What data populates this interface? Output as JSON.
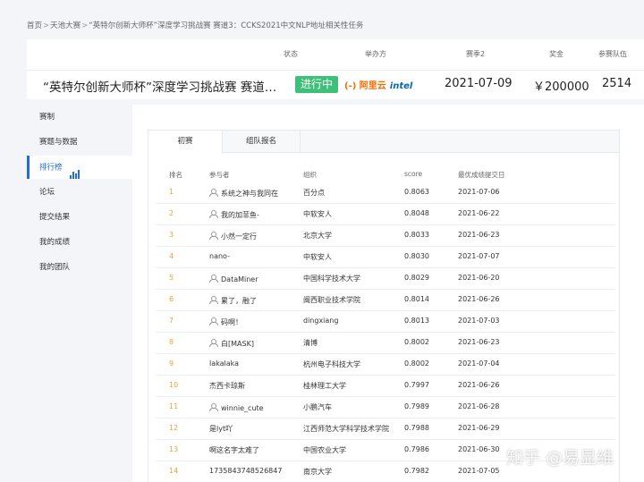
{
  "breadcrumb": [
    "首页",
    "天池大赛",
    "“英特尔创新大师杯”深度学习挑战赛 赛道3：CCKS2021中文NLP地址相关性任务"
  ],
  "header": {
    "labels": {
      "status": "状态",
      "organizer": "举办方",
      "season": "赛季2",
      "prize": "奖金",
      "participants": "参赛队伍"
    },
    "title": "“英特尔创新大师杯”深度学习挑战赛 赛道3：CCKS2021中文NLP地址相关性任务",
    "status": "进行中",
    "organizer_logo": {
      "aliyun": "(-) 阿里云",
      "intel": "intel"
    },
    "season_date": "2021-07-09",
    "prize": "￥200000",
    "participants": "2514"
  },
  "sidebar": {
    "items": [
      {
        "label": "赛制"
      },
      {
        "label": "赛题与数据"
      },
      {
        "label": "排行榜"
      },
      {
        "label": "论坛"
      },
      {
        "label": "提交结果"
      },
      {
        "label": "我的成绩"
      },
      {
        "label": "我的团队"
      }
    ],
    "active_index": 2
  },
  "tabs": [
    {
      "label": "初赛"
    },
    {
      "label": "组队报名"
    }
  ],
  "leaderboard": {
    "columns": [
      "排名",
      "参与者",
      "组织",
      "score",
      "最优成绩提交日"
    ],
    "rows": [
      {
        "rank": "1",
        "name": "系统之神与我同在",
        "org": "百分点",
        "score": "0.8063",
        "date": "2021-07-06",
        "avatar": true
      },
      {
        "rank": "2",
        "name": "我的加菲鱼-",
        "org": "中软安人",
        "score": "0.8048",
        "date": "2021-06-22",
        "avatar": true
      },
      {
        "rank": "3",
        "name": "小然一定行",
        "org": "北京大学",
        "score": "0.8033",
        "date": "2021-06-23",
        "avatar": true
      },
      {
        "rank": "4",
        "name": "nano-",
        "org": "中软安人",
        "score": "0.8030",
        "date": "2021-07-07",
        "avatar": false
      },
      {
        "rank": "5",
        "name": "DataMiner",
        "org": "中国科学技术大学",
        "score": "0.8029",
        "date": "2021-06-20",
        "avatar": true
      },
      {
        "rank": "6",
        "name": "累了，融了",
        "org": "闽西职业技术学院",
        "score": "0.8014",
        "date": "2021-06-26",
        "avatar": true
      },
      {
        "rank": "7",
        "name": "码啊！",
        "org": "dingxiang",
        "score": "0.8013",
        "date": "2021-07-03",
        "avatar": true
      },
      {
        "rank": "8",
        "name": "白[MASK]",
        "org": "清博",
        "score": "0.8002",
        "date": "2021-06-23",
        "avatar": true
      },
      {
        "rank": "9",
        "name": "lakalaka",
        "org": "杭州电子科技大学",
        "score": "0.8002",
        "date": "2021-07-04",
        "avatar": false
      },
      {
        "rank": "10",
        "name": "杰西卡琼斯",
        "org": "桂林理工大学",
        "score": "0.7997",
        "date": "2021-06-26",
        "avatar": false
      },
      {
        "rank": "11",
        "name": "winnie_cute",
        "org": "小鹏汽车",
        "score": "0.7989",
        "date": "2021-06-28",
        "avatar": true
      },
      {
        "rank": "12",
        "name": "是lyt吖",
        "org": "江西师范大学科学技术学院",
        "score": "0.7988",
        "date": "2021-06-29",
        "avatar": false
      },
      {
        "rank": "13",
        "name": "啊这名字太难了",
        "org": "中国农业大学",
        "score": "0.7986",
        "date": "2021-06-30",
        "avatar": false
      },
      {
        "rank": "14",
        "name": "1735843748526847",
        "org": "南京大学",
        "score": "0.7982",
        "date": "2021-07-05",
        "avatar": false
      }
    ]
  },
  "watermark": "知乎 @易显维",
  "colors": {
    "accent": "#1f6fd6",
    "status_green": "#3ec07a",
    "rank_orange": "#f0a030"
  }
}
